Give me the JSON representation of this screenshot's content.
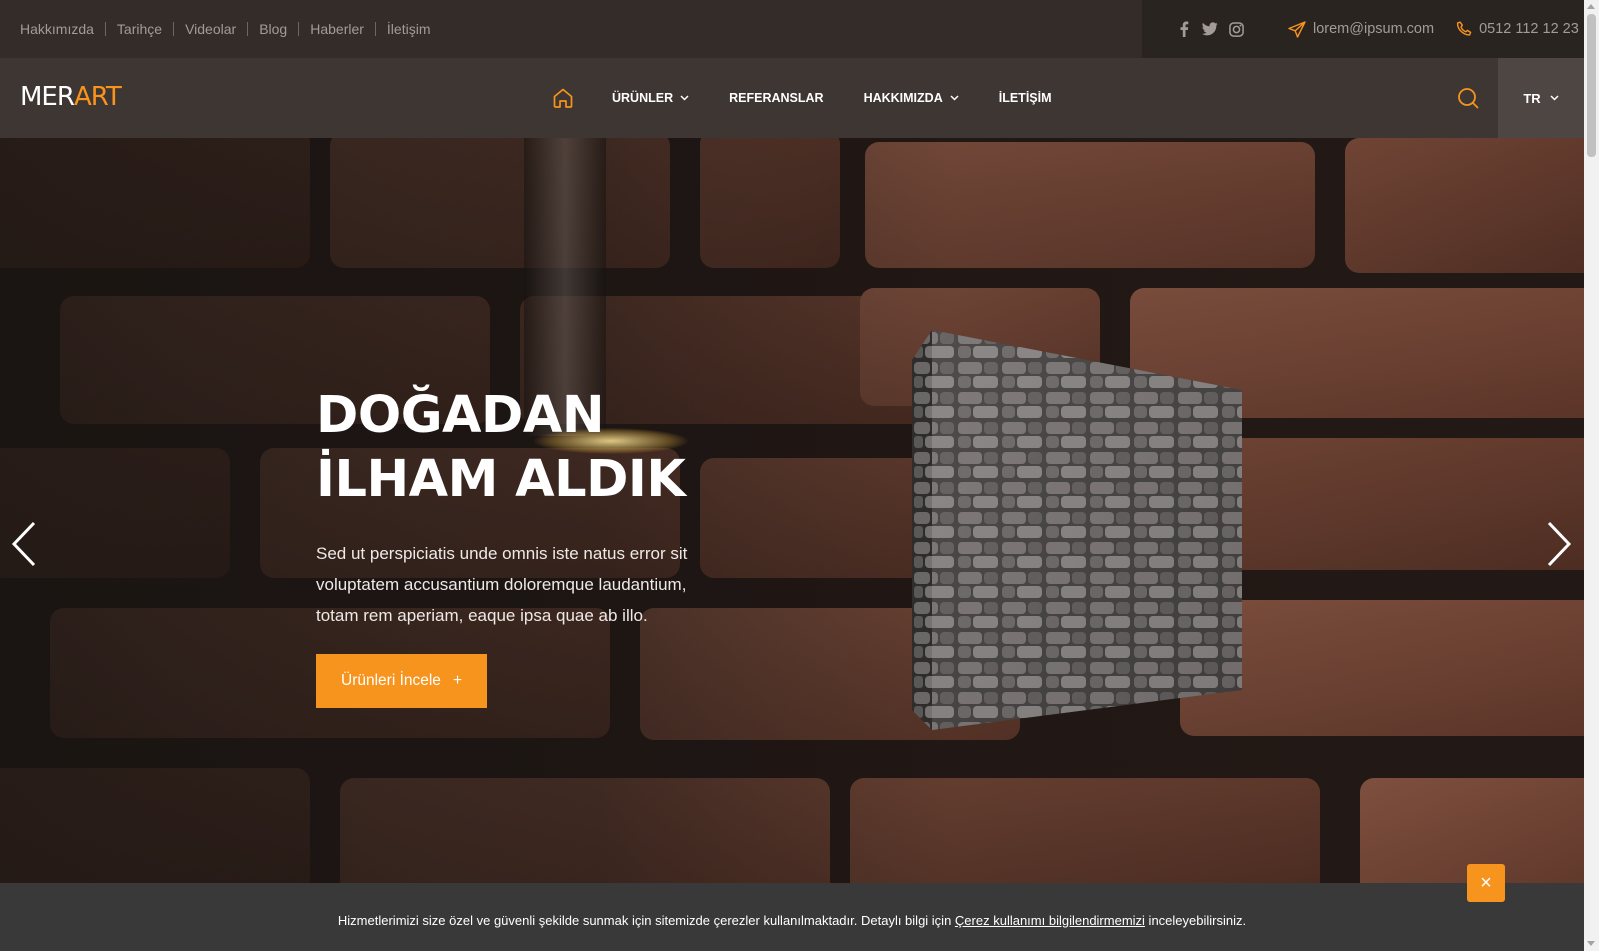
{
  "topbar": {
    "links": [
      "Hakkımızda",
      "Tarihçe",
      "Videolar",
      "Blog",
      "Haberler",
      "İletişim"
    ],
    "socials": [
      "facebook-icon",
      "twitter-icon",
      "instagram-icon"
    ],
    "email": "lorem@ipsum.com",
    "phone": "0512 112 12 23"
  },
  "nav": {
    "logo_part1": "MER",
    "logo_part2": "ART",
    "items": [
      {
        "label": "ÜRÜNLER",
        "dropdown": true
      },
      {
        "label": "REFERANSLAR",
        "dropdown": false
      },
      {
        "label": "HAKKIMIZDA",
        "dropdown": true
      },
      {
        "label": "İLETİŞİM",
        "dropdown": false
      }
    ],
    "language": "TR"
  },
  "hero": {
    "title_line1": "DOĞADAN",
    "title_line2": "İLHAM ALDIK",
    "text": "Sed ut perspiciatis unde omnis iste natus error sit voluptatem accusantium doloremque laudantium, totam rem aperiam, eaque ipsa quae ab illo.",
    "cta_label": "Ürünleri İncele",
    "cta_icon": "+"
  },
  "cookie": {
    "text_before": "Hizmetlerimizi size özel ve güvenli şekilde sunmak için sitemizde çerezler kullanılmaktadır. Detaylı bilgi için ",
    "link_text": "Çerez kullanımı bilgilendirmemizi",
    "text_after": " inceleyebilirsiniz.",
    "close_label": "×"
  },
  "colors": {
    "accent": "#f7941d",
    "topbar": "#332c29",
    "navbar": "#3e3633",
    "cookie": "#393939"
  }
}
